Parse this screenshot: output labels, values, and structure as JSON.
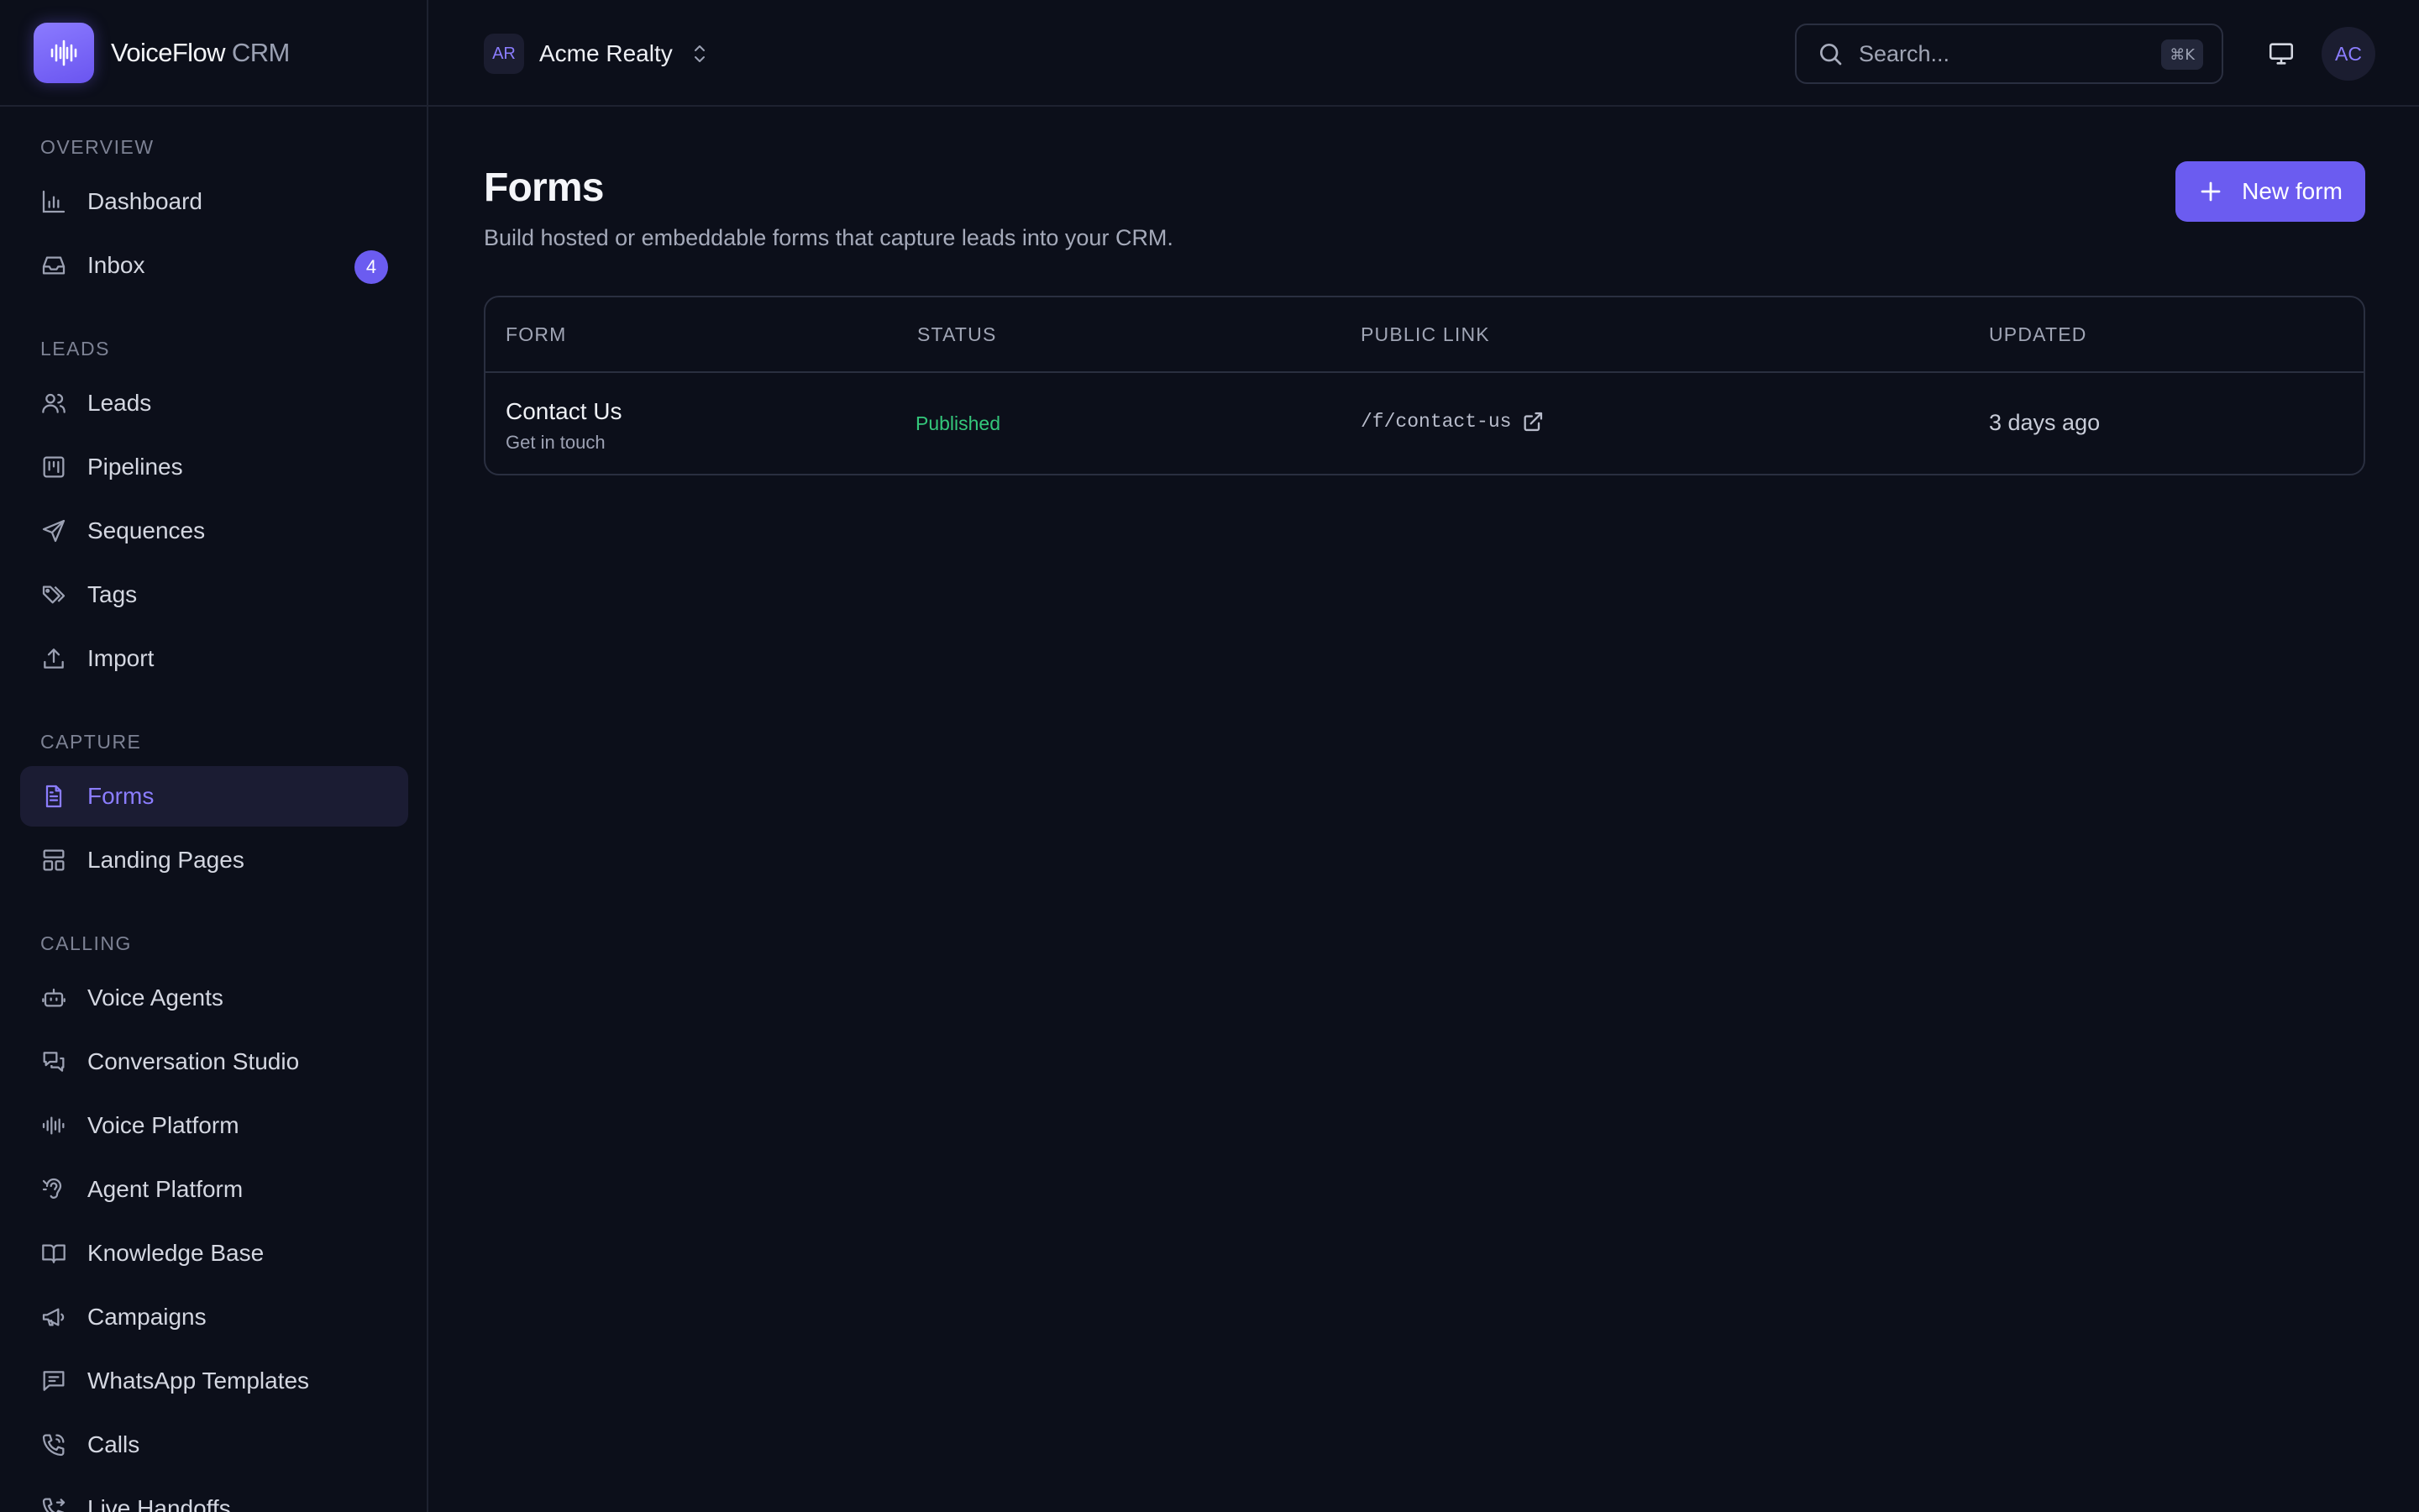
{
  "brand": {
    "name": "VoiceFlow",
    "suffix": "CRM"
  },
  "workspace": {
    "initials": "AR",
    "name": "Acme Realty"
  },
  "search": {
    "placeholder": "Search...",
    "shortcut": "⌘K"
  },
  "user": {
    "initials": "AC"
  },
  "sidebar": {
    "sections": {
      "overview": "OVERVIEW",
      "leads": "LEADS",
      "capture": "CAPTURE",
      "calling": "CALLING"
    },
    "items": {
      "dashboard": "Dashboard",
      "inbox": "Inbox",
      "inbox_badge": "4",
      "leads": "Leads",
      "pipelines": "Pipelines",
      "sequences": "Sequences",
      "tags": "Tags",
      "import": "Import",
      "forms": "Forms",
      "landing_pages": "Landing Pages",
      "voice_agents": "Voice Agents",
      "conversation_studio": "Conversation Studio",
      "voice_platform": "Voice Platform",
      "agent_platform": "Agent Platform",
      "knowledge_base": "Knowledge Base",
      "campaigns": "Campaigns",
      "whatsapp_templates": "WhatsApp Templates",
      "calls": "Calls",
      "live_handoffs": "Live Handoffs"
    },
    "active": "forms"
  },
  "main": {
    "title": "Forms",
    "subtitle": "Build hosted or embeddable forms that capture leads into your CRM.",
    "new_button": "New form",
    "table": {
      "headers": {
        "form": "FORM",
        "status": "STATUS",
        "public_link": "PUBLIC LINK",
        "updated": "UPDATED"
      },
      "rows": [
        {
          "name": "Contact Us",
          "description": "Get in touch",
          "status": "Published",
          "public_link": "/f/contact-us",
          "updated": "3 days ago"
        }
      ]
    }
  },
  "colors": {
    "background": "#0c0f1a",
    "accent": "#6b5cf0",
    "active_text": "#8b7dff",
    "status_published": "#34c77b"
  }
}
